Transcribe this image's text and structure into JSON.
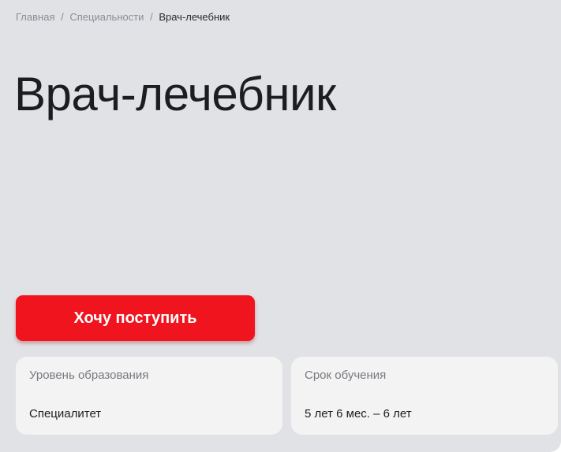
{
  "breadcrumb": {
    "items": [
      {
        "label": "Главная"
      },
      {
        "label": "Специальности"
      }
    ],
    "separator": "/",
    "current": "Врач-лечебник"
  },
  "hero": {
    "title": "Врач-лечебник",
    "apply_label": "Хочу поступить"
  },
  "info": {
    "level": {
      "label": "Уровень образования",
      "value": "Специалитет"
    },
    "duration": {
      "label": "Срок обучения",
      "value": "5 лет 6 мес. – 6 лет"
    }
  },
  "colors": {
    "background": "#e1e2e6",
    "accent": "#ef141e",
    "card": "#f3f3f3",
    "text": "#1d1d1f",
    "muted": "#8b8d94"
  }
}
